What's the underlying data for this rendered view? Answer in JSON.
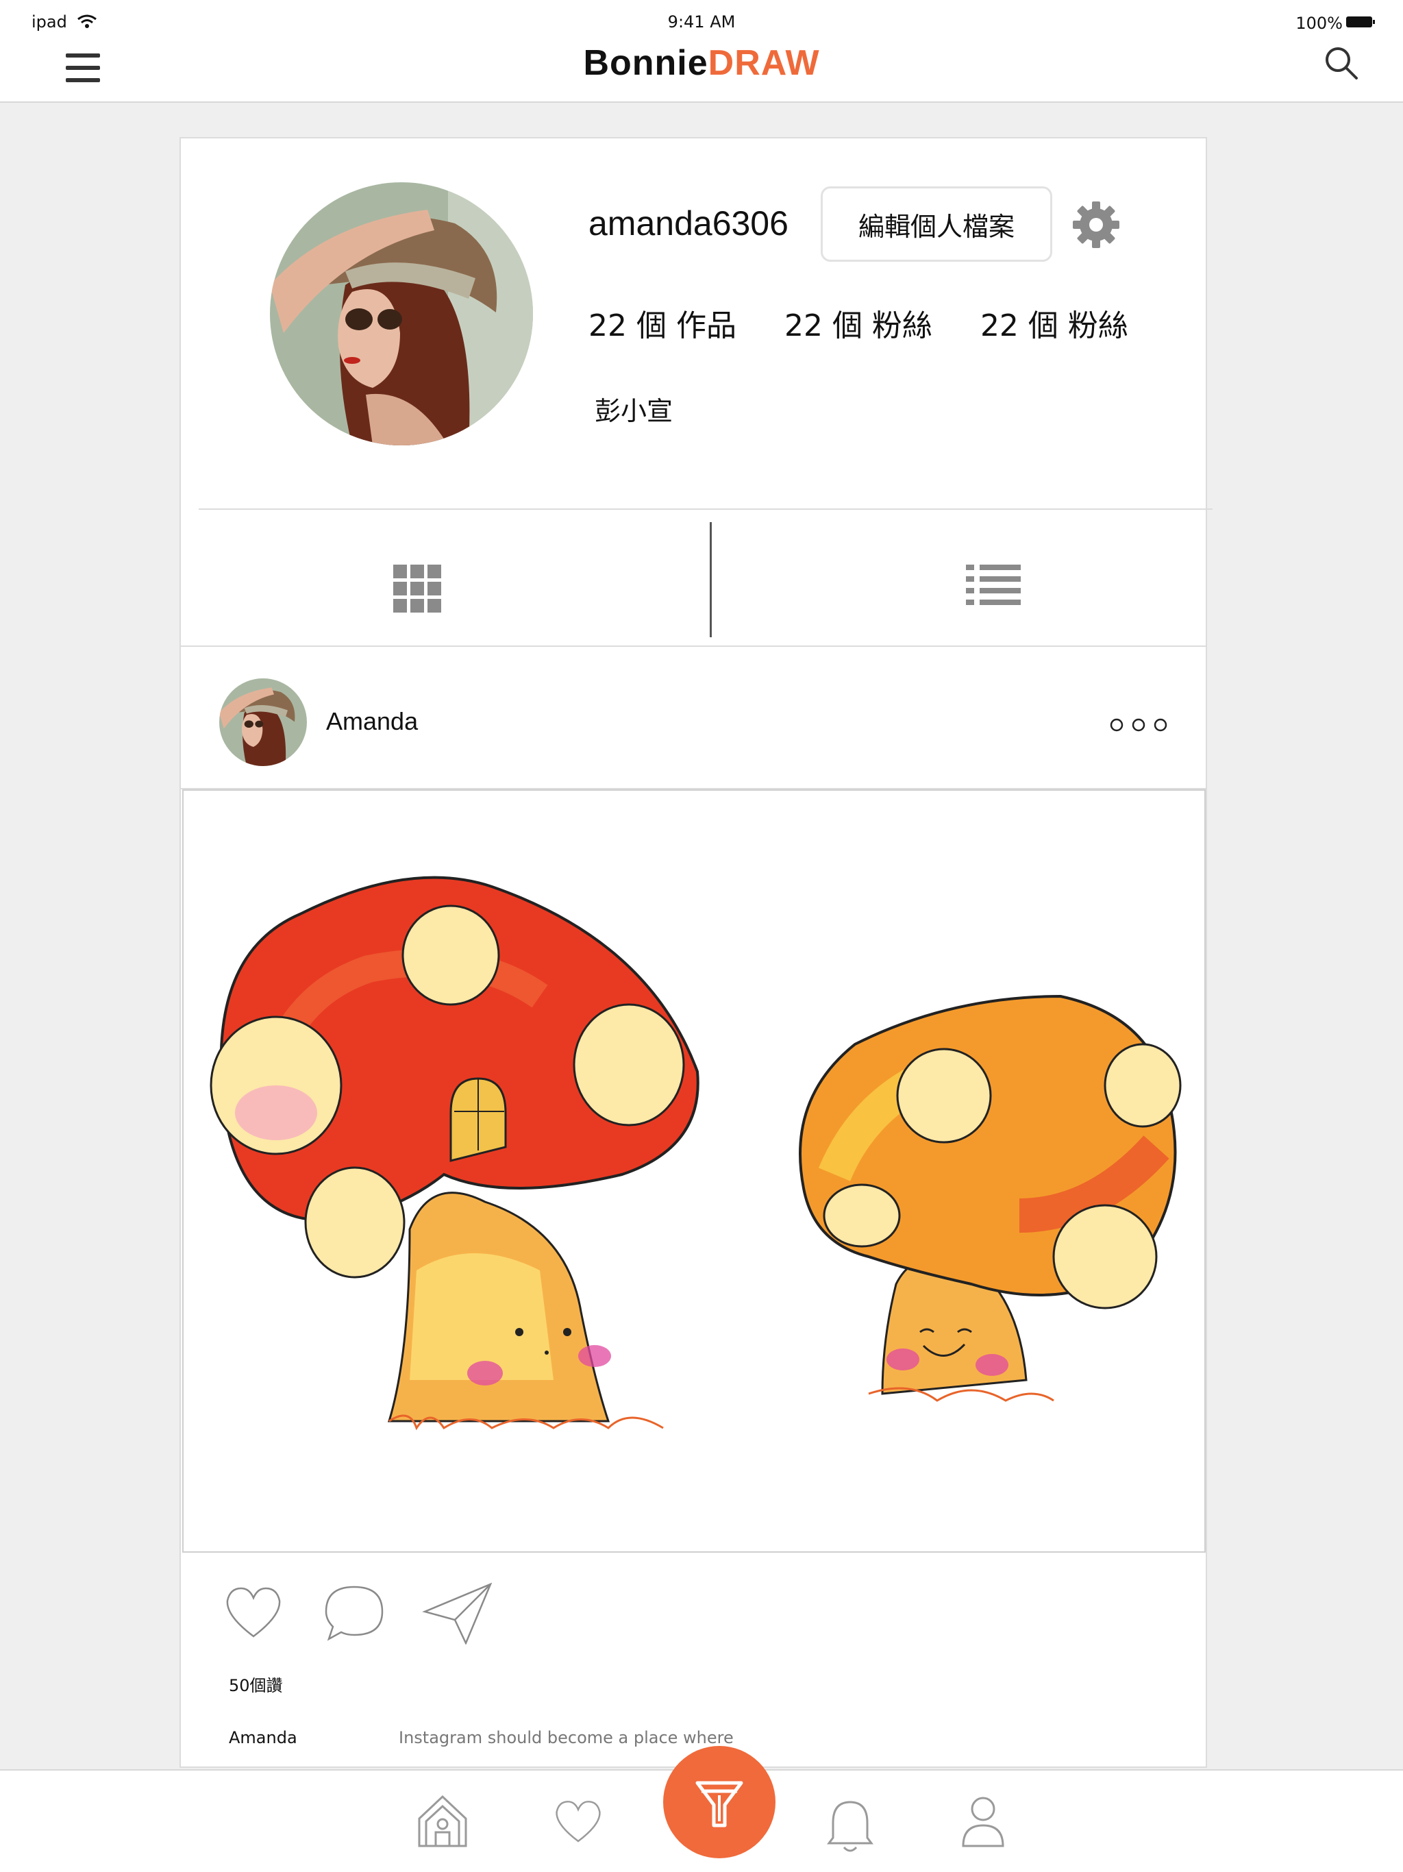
{
  "status_bar": {
    "carrier": "ipad",
    "time": "9:41 AM",
    "battery": "100%"
  },
  "nav": {
    "logo_part1": "Bonnie",
    "logo_part2": "DRAW"
  },
  "profile": {
    "username": "amanda6306",
    "edit_label": "編輯個人檔案",
    "stats": [
      "22 個 作品",
      "22 個 粉絲",
      "22 個 粉絲"
    ],
    "full_name": "彭小宣"
  },
  "post": {
    "author": "Amanda",
    "likes": "50個讚",
    "caption_user": "Amanda",
    "caption_text": "Instagram should become a place where"
  },
  "colors": {
    "accent": "#f06a3b",
    "icon_gray": "#8a8a8a"
  },
  "icons": [
    "menu-icon",
    "search-icon",
    "gear-icon",
    "grid-icon",
    "list-icon",
    "more-icon",
    "heart-icon",
    "comment-icon",
    "send-icon",
    "home-icon",
    "favorite-icon",
    "brush-icon",
    "bell-icon",
    "user-icon"
  ]
}
